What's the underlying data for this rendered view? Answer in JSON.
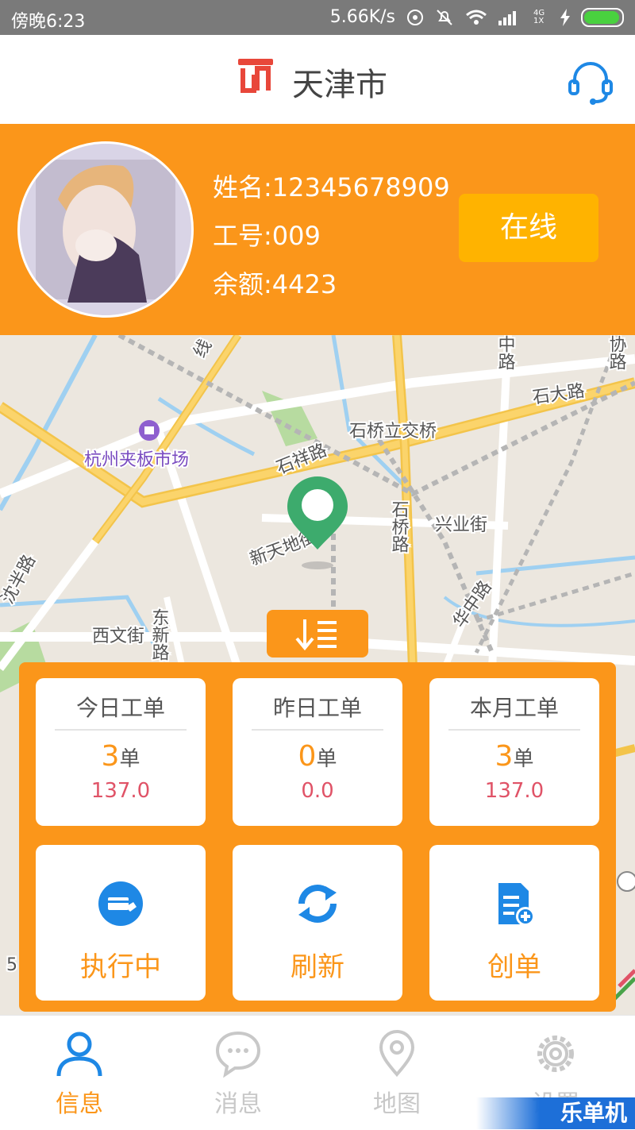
{
  "status_bar": {
    "time": "傍晚6:23",
    "speed": "5.66K/s",
    "network": "4G 1X",
    "colors": {
      "background": "#7a7a7a",
      "battery": "#49d13f"
    }
  },
  "header": {
    "city": "天津市",
    "logo_icon": "app-logo-icon",
    "service_icon": "headset-icon"
  },
  "profile": {
    "name_line": "姓名:12345678909",
    "id_line": "工号:009",
    "balance_line": "余额:4423",
    "status_button": "在线"
  },
  "map": {
    "labels": {
      "xian": "线",
      "zhonglu": "中路",
      "xie_lu": "协路",
      "shida": "石大路",
      "shiqiao_bridge": "石桥立交桥",
      "market": "杭州夹板市场",
      "shixiang": "石祥路",
      "shiqiao_road": "石桥路",
      "xingye": "兴业街",
      "xintian": "新天地街",
      "shenban": "沈半路",
      "dongxin": "东新路",
      "xiwen": "西文街",
      "huazhong": "华中路",
      "scale": "5"
    },
    "marker_icon": "map-pin-icon"
  },
  "toggle_icon": "sort-down-icon",
  "stats": [
    {
      "title": "今日工单",
      "count": "3",
      "unit": "单",
      "amount": "137.0"
    },
    {
      "title": "昨日工单",
      "count": "0",
      "unit": "单",
      "amount": "0.0"
    },
    {
      "title": "本月工单",
      "count": "3",
      "unit": "单",
      "amount": "137.0"
    }
  ],
  "actions": [
    {
      "label": "执行中",
      "icon": "payment-card-icon"
    },
    {
      "label": "刷新",
      "icon": "refresh-icon"
    },
    {
      "label": "创单",
      "icon": "new-document-icon"
    }
  ],
  "tabs": [
    {
      "label": "信息",
      "icon": "user-icon",
      "active": true
    },
    {
      "label": "消息",
      "icon": "chat-bubble-icon",
      "active": false
    },
    {
      "label": "地图",
      "icon": "location-icon",
      "active": false
    },
    {
      "label": "设置",
      "icon": "gear-icon",
      "active": false
    }
  ],
  "watermark": "乐单机",
  "colors": {
    "accent": "#fb961a",
    "button": "#ffb300",
    "amount": "#e05367",
    "icon_blue": "#1e88e5"
  }
}
